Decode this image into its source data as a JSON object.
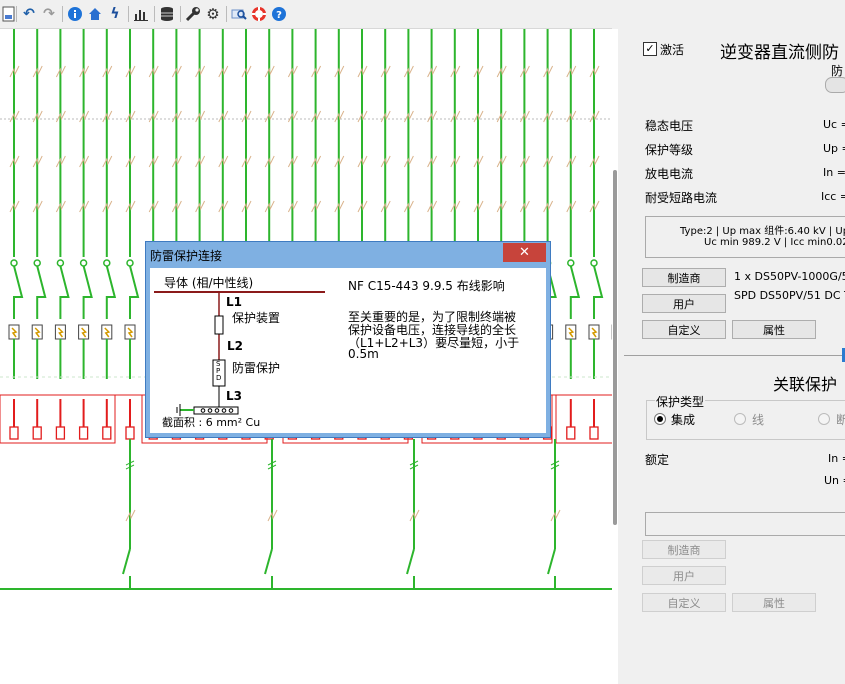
{
  "toolbar": {
    "icons": [
      "document-icon",
      "undo-icon",
      "redo-icon",
      "info-icon",
      "home-icon",
      "lightning-icon",
      "bar-chart-icon",
      "database-icon",
      "wrench-icon",
      "gear-icon",
      "zoom-icon",
      "help-ring-icon",
      "help-icon"
    ]
  },
  "panel": {
    "activate_label": "激活",
    "section_title": "逆变器直流侧防",
    "sub_label": "防",
    "rows": [
      {
        "label": "稳态电压",
        "value": "Uc ="
      },
      {
        "label": "保护等级",
        "value": "Up ="
      },
      {
        "label": "放电电流",
        "value": "In ="
      },
      {
        "label": "耐受短路电流",
        "value": "Icc ="
      }
    ],
    "type_line1": "Type:2 | Up max 组件:6.40  kV | Up",
    "type_line2": "Uc min 989.2 V | Icc min0.02",
    "manufacturer_button": "制造商",
    "manufacturer_value": "1 x DS50PV-1000G/51",
    "user_button": "用户",
    "user_value": "SPD DS50PV/51 DC Ty",
    "custom_button": "自定义",
    "properties_button": "属性",
    "assoc_title": "关联保护",
    "protection_type_label": "保护类型",
    "radio_integrated": "集成",
    "radio_line": "线",
    "radio_other": "断",
    "rated_label": "额定",
    "in_label": "In =",
    "un_label": "Un =",
    "manufacturer_button_2": "制造商",
    "user_button_2": "用户",
    "custom_button_2": "自定义",
    "properties_button_2": "属性"
  },
  "dialog": {
    "title": "防雷保护连接",
    "close_symbol": "✕",
    "conductor_label": "导体 (相/中性线)",
    "l1": "L1",
    "l2": "L2",
    "l3": "L3",
    "protective_device": "保护装置",
    "lightning_protection": "防雷保护",
    "spd_text": "SPD",
    "cross_section": "截面积 : 6 mm² Cu",
    "standard_title": "NF C15-443 9.9.5 布线影响",
    "note_line1": "至关重要的是，为了限制终端被",
    "note_line2": "保护设备电压，连接导线的全长",
    "note_line3": "（L1+L2+L3）要尽量短，小于",
    "note_line4": "0.5m"
  },
  "colors": {
    "green": "#2db52d",
    "red": "#e21c1c",
    "dark_red": "#8b1a1a",
    "dialog_blue": "#7fb0e2",
    "close_red": "#c7443b"
  }
}
